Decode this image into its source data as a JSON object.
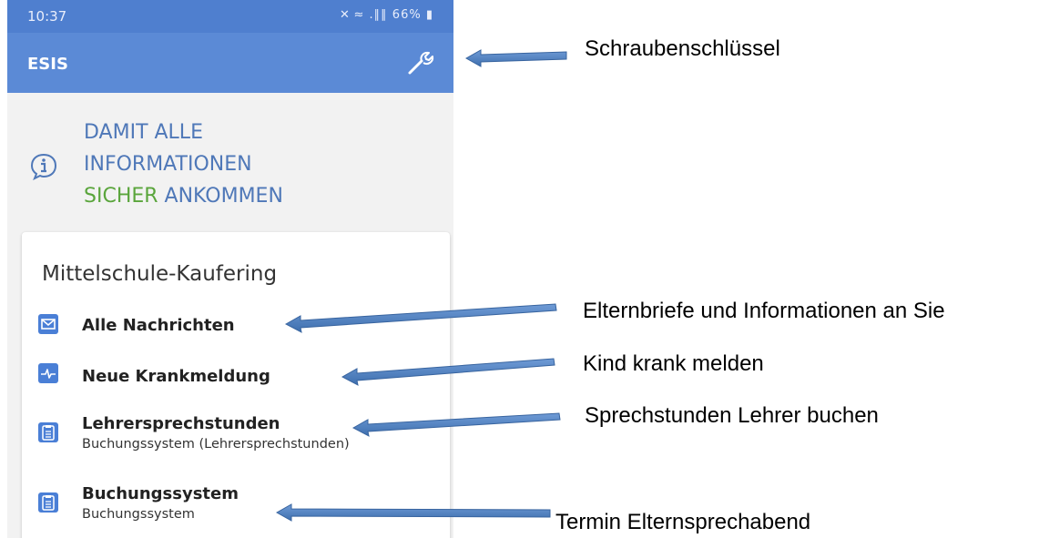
{
  "status_bar": {
    "time": "10:37",
    "indicators": "✕ ≈ .∥∥ 66% ▮",
    "battery": "66%"
  },
  "app_bar": {
    "title": "ESIS",
    "settings_icon": "wrench-icon"
  },
  "info_banner": {
    "icon": "info-icon",
    "line1": "DAMIT ALLE",
    "line2": "INFORMATIONEN",
    "line3_green": "SICHER",
    "line3_blue": "ANKOMMEN"
  },
  "card": {
    "title": "Mittelschule-Kaufering",
    "items": [
      {
        "label": "Alle Nachrichten",
        "sub": "",
        "icon": "mail-icon"
      },
      {
        "label": "Neue Krankmeldung",
        "sub": "",
        "icon": "pulse-icon"
      },
      {
        "label": "Lehrersprechstunden",
        "sub": "Buchungssystem (Lehrersprechstunden)",
        "icon": "clipboard-icon"
      },
      {
        "label": "Buchungssystem",
        "sub": "Buchungssystem",
        "icon": "clipboard-icon"
      }
    ]
  },
  "annotations": {
    "wrench": "Schraubenschlüssel",
    "messages": "Elternbriefe und Informationen an Sie",
    "sick": "Kind krank melden",
    "office_hours": "Sprechstunden Lehrer buchen",
    "booking": "Termin Elternsprechabend"
  },
  "colors": {
    "app_bar": "#5b8ad6",
    "status_bar": "#4f7fcf",
    "accent_blue": "#4f78b8",
    "accent_green": "#5aa53c",
    "icon_blue": "#4a7fd6",
    "arrow": "#4f81bd"
  }
}
